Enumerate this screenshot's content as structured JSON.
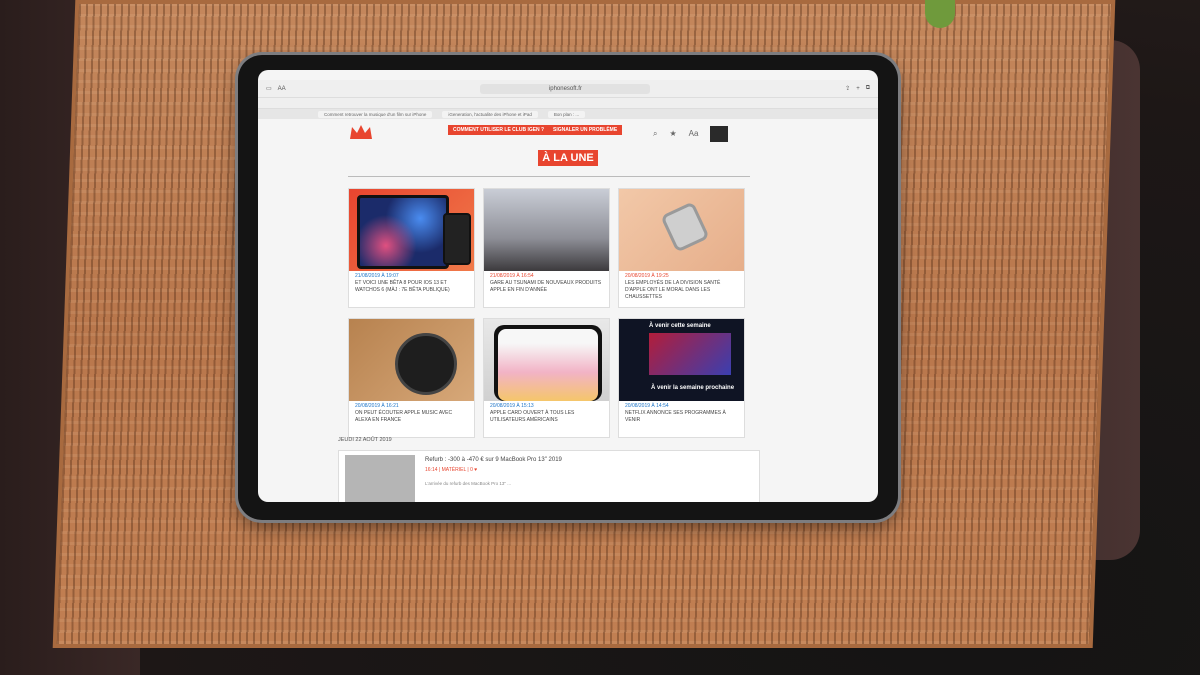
{
  "browser": {
    "url": "iphonesoft.fr",
    "tabs": [
      "Comment retrouver la musique d'un film sur iPhone",
      "iGeneration, l'actualite des iPhone et iPad",
      "Bon plan : ..."
    ]
  },
  "site": {
    "btn_club": "COMMENT UTILISER LE CLUB IGEN ?",
    "btn_report": "SIGNALER UN PROBLÈME",
    "section_title": "À LA UNE"
  },
  "cards": [
    {
      "meta": "21/08/2019 À 19:07",
      "title": "ET VOICI UNE BÊTA 8 POUR IOS 13 ET WATCHOS 6 (MÀJ : 7E BÊTA PUBLIQUE)"
    },
    {
      "meta": "21/08/2019 À 16:54",
      "title": "GARE AU TSUNAMI DE NOUVEAUX PRODUITS APPLE EN FIN D'ANNÉE"
    },
    {
      "meta": "20/08/2019 À 19:25",
      "title": "LES EMPLOYÉS DE LA DIVISION SANTÉ D'APPLE ONT LE MORAL DANS LES CHAUSSETTES"
    },
    {
      "meta": "20/08/2019 À 16:21",
      "title": "ON PEUT ÉCOUTER APPLE MUSIC AVEC ALEXA EN FRANCE"
    },
    {
      "meta": "20/08/2019 À 15:13",
      "title": "APPLE CARD OUVERT À TOUS LES UTILISATEURS AMÉRICAINS"
    },
    {
      "meta": "20/08/2019 À 14:54",
      "title": "NETFLIX ANNONCE SES PROGRAMMES À VENIR",
      "thumb_top": "À venir cette semaine",
      "thumb_bottom": "À venir la semaine prochaine"
    }
  ],
  "date_heading": "JEUDI 22 AOÛT 2019",
  "article": {
    "title": "Refurb : -300 à -470 € sur 9 MacBook Pro 13\" 2019",
    "sub": "16:14 | MATÉRIEL | 0 ♥",
    "body": "L'arrivée du refurb des MacBook Pro 13\" ..."
  },
  "colors": {
    "accent": "#e8452f",
    "date_blue": "#1a73c8"
  }
}
